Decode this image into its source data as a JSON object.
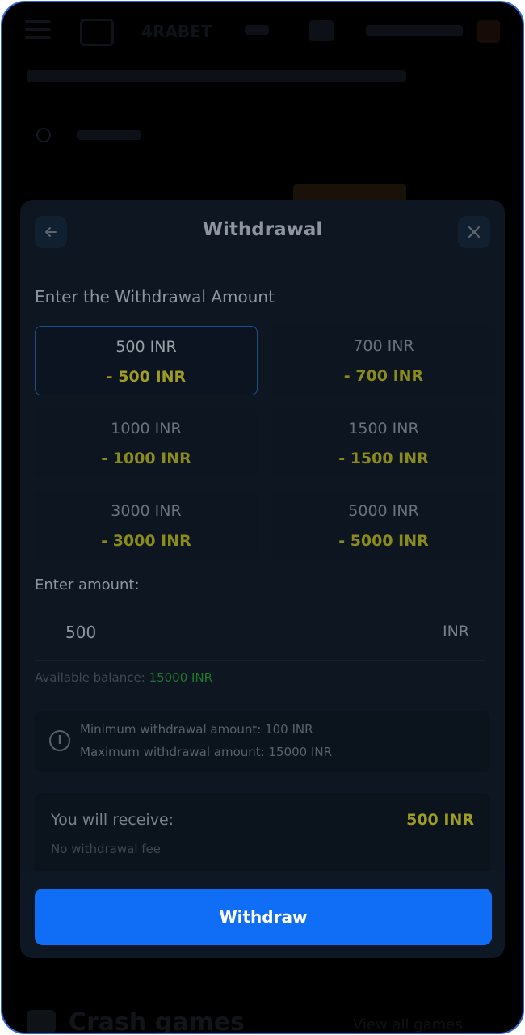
{
  "background": {
    "logo": "4RABET",
    "section_title": "Crash games",
    "view_all": "View all games"
  },
  "modal": {
    "title": "Withdrawal",
    "back_icon": "arrow-left-icon",
    "close_icon": "close-icon"
  },
  "amount_section": {
    "title": "Enter the Withdrawal Amount",
    "options": [
      {
        "amount": "500 INR",
        "bonus": "- 500 INR",
        "selected": true
      },
      {
        "amount": "700 INR",
        "bonus": "- 700 INR",
        "selected": false
      },
      {
        "amount": "1000 INR",
        "bonus": "- 1000 INR",
        "selected": false
      },
      {
        "amount": "1500 INR",
        "bonus": "- 1500 INR",
        "selected": false
      },
      {
        "amount": "3000 INR",
        "bonus": "- 3000 INR",
        "selected": false
      },
      {
        "amount": "5000 INR",
        "bonus": "- 5000 INR",
        "selected": false
      }
    ]
  },
  "amount_input": {
    "label": "Enter amount:",
    "value": "500",
    "currency": "INR"
  },
  "balance": {
    "label": "Available balance: ",
    "value": "15000 INR"
  },
  "limits": {
    "icon": "info-icon",
    "min": "Minimum withdrawal amount: 100 INR",
    "max": "Maximum withdrawal amount: 15000 INR"
  },
  "receive": {
    "label": "You will receive:",
    "value": "500 INR",
    "fee": "No withdrawal fee"
  },
  "action": {
    "withdraw_label": "Withdraw"
  },
  "colors": {
    "accent": "#0f6ef5",
    "bonus": "#9e9c22",
    "balance": "#1d7a2b",
    "border": "#2f66d6"
  }
}
